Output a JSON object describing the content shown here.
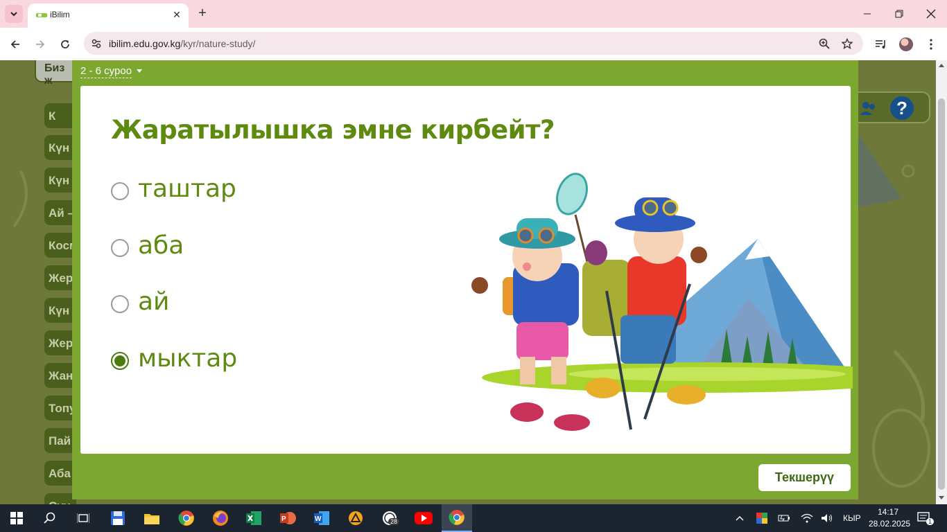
{
  "browser": {
    "tab_title": "iBilim",
    "url_host": "ibilim.edu.gov.kg",
    "url_path": "/kyr/nature-study/"
  },
  "page": {
    "top_button": "Биз ж",
    "sidebar_items": [
      "К",
      "Күн",
      "Күн",
      "Ай –",
      "Косм",
      "Жер",
      "Күн",
      "Жер",
      "Жан",
      "Топу",
      "Пай",
      "Аба",
      "Суу"
    ],
    "help_label": "?"
  },
  "quiz": {
    "question_selector": "2 - 6 суроо",
    "question": "Жаратылышка эмне кирбейт?",
    "options": [
      "таштар",
      "аба",
      "ай",
      "мыктар"
    ],
    "selected_index": 3,
    "check_button": "Текшерүү"
  },
  "taskbar": {
    "keyboard_lang": "КЫР",
    "time": "14:17",
    "date": "28.02.2025",
    "notification_count": "1",
    "whatsapp_badge": "28"
  },
  "colors": {
    "accent_green": "#7ca832",
    "question_green": "#5e8a10"
  }
}
